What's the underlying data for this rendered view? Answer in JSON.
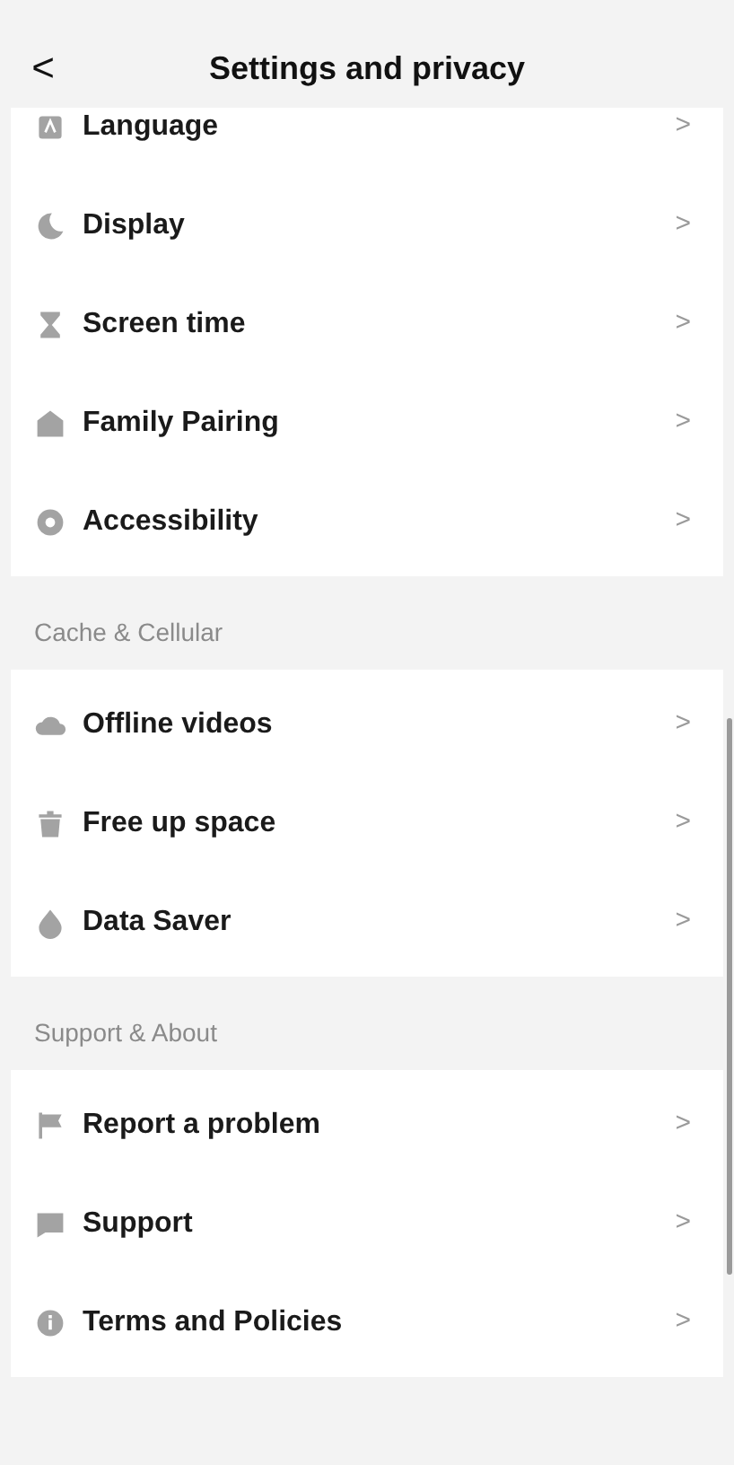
{
  "header": {
    "back": "<",
    "title": "Settings and privacy"
  },
  "sections": [
    {
      "items": [
        {
          "label": "Language",
          "arrow": ">"
        },
        {
          "label": "Display",
          "arrow": ">"
        },
        {
          "label": "Screen time",
          "arrow": ">"
        },
        {
          "label": "Family Pairing",
          "arrow": ">"
        },
        {
          "label": "Accessibility",
          "arrow": ">"
        }
      ]
    },
    {
      "heading": "Cache & Cellular",
      "items": [
        {
          "label": "Offline videos",
          "arrow": ">"
        },
        {
          "label": "Free up space",
          "arrow": ">"
        },
        {
          "label": "Data Saver",
          "arrow": ">"
        }
      ]
    },
    {
      "heading": "Support & About",
      "items": [
        {
          "label": "Report a problem",
          "arrow": ">"
        },
        {
          "label": "Support",
          "arrow": ">"
        },
        {
          "label": "Terms and Policies",
          "arrow": ">"
        }
      ]
    }
  ]
}
